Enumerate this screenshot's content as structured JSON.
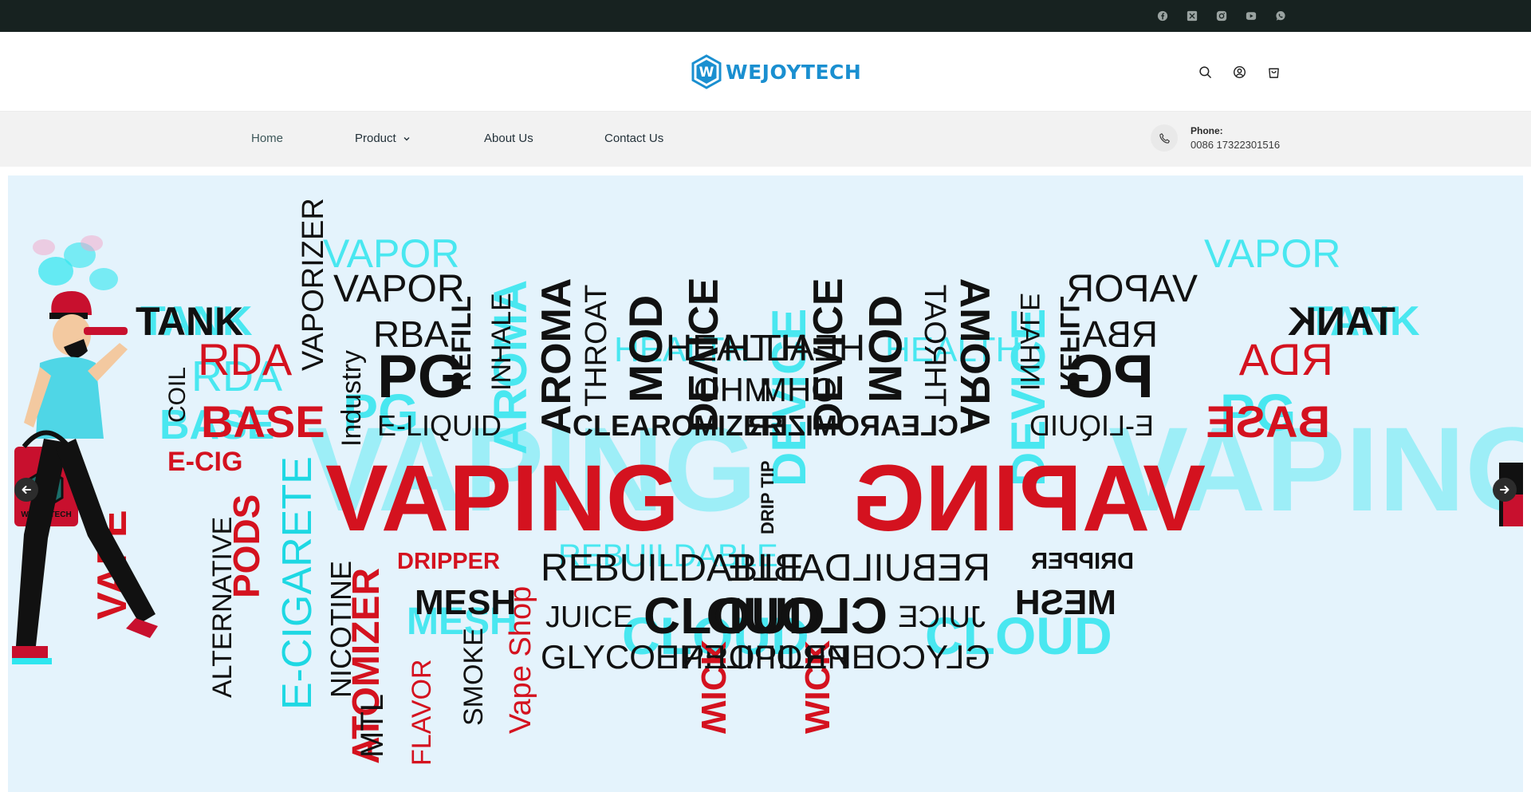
{
  "topbar": {
    "socials": [
      "facebook-icon",
      "x-twitter-icon",
      "instagram-icon",
      "youtube-icon",
      "whatsapp-icon"
    ]
  },
  "header": {
    "logo_text": "WEJOYTECH",
    "logo_mark_letter": "W",
    "brand_color": "#1a8fd0",
    "icons": [
      "search-icon",
      "user-account-icon",
      "shopping-cart-icon"
    ]
  },
  "nav": {
    "items": [
      {
        "label": "Home",
        "active": true
      },
      {
        "label": "Product",
        "has_dropdown": true
      },
      {
        "label": "About Us"
      },
      {
        "label": "Contact Us"
      }
    ],
    "phone": {
      "label": "Phone:",
      "number": "0086 17322301516"
    }
  },
  "hero": {
    "bag_logo_text": "WEJOYTECH",
    "words_left": {
      "main": "VAPING",
      "row1": [
        "TANK",
        "VAPOR",
        "RBA",
        "HEALTH"
      ],
      "row2": [
        "RDA",
        "PG",
        "REFILL",
        "INHALE",
        "AROMA",
        "THROAT",
        "MOD",
        "OHM"
      ],
      "row3": [
        "BASE",
        "E-LIQUID",
        "CLEAROMIZER",
        "DEVICE"
      ],
      "row4": [
        "COIL",
        "E-CIG",
        "VAPORIZER",
        "Industry",
        "DRIP TIP"
      ],
      "row5": [
        "DRIPPER",
        "REBUILDABLE",
        "WICK"
      ],
      "row6": [
        "MESH",
        "JUICE",
        "CLOUD"
      ],
      "row7": [
        "GLYCOL PROPILENE"
      ],
      "vertical": [
        "VAPE",
        "ALTERNATIVE",
        "PODS",
        "E-CIGARETE",
        "NICOTINE",
        "ATOMIZER",
        "MTL",
        "FLAVOR",
        "SMOKE",
        "Vape Shop"
      ]
    },
    "words_right_mirrored": {
      "main": "VAPING",
      "row1": [
        "HEALTH",
        "VAPOR",
        "RBA",
        "TANK"
      ],
      "row2": [
        "OHM",
        "MOD",
        "THROAT",
        "AROMA",
        "INHALE",
        "REFILL",
        "PG",
        "RDA"
      ],
      "row3": [
        "DEVICE",
        "CLEAROMIZER",
        "E-LIQUID",
        "BASE"
      ],
      "row5": [
        "WICK",
        "REBUILDABLE",
        "DRIPPER"
      ],
      "row6": [
        "CLOUD",
        "JUICE",
        "MESH"
      ],
      "row7": [
        "GLYCOL PROPILENE"
      ]
    },
    "colors": {
      "red": "#d4121f",
      "cyan": "#2ee6ef",
      "black": "#111111"
    },
    "prev_label": "previous slide",
    "next_label": "next slide"
  }
}
